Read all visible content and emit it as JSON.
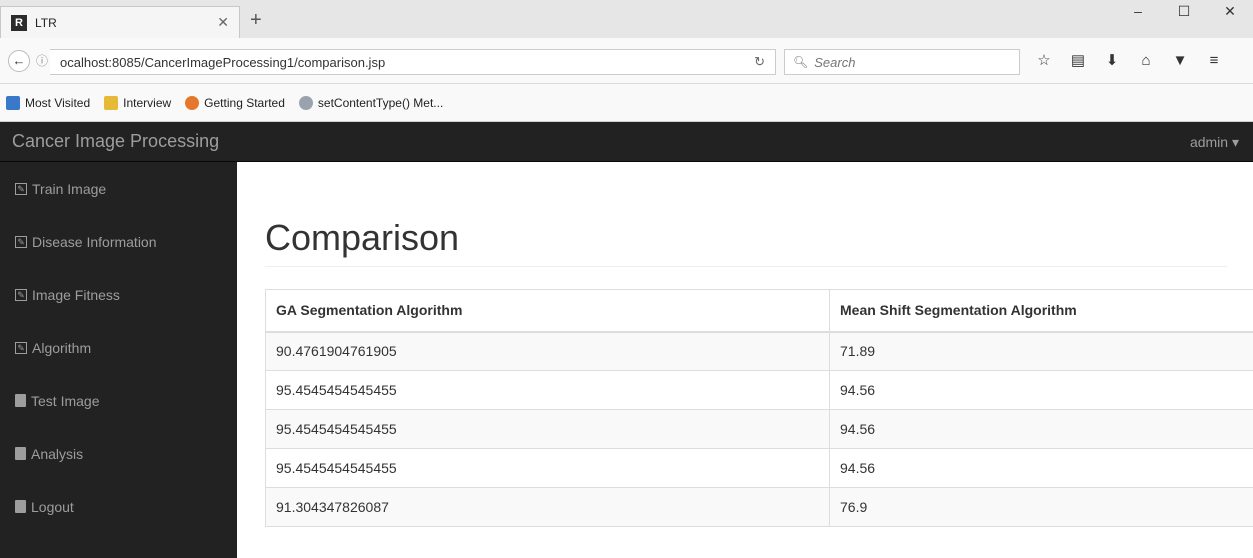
{
  "browser": {
    "tab_title": "LTR",
    "tab_icon": "R",
    "url": "ocalhost:8085/CancerImageProcessing1/comparison.jsp",
    "search_placeholder": "Search",
    "bookmarks": [
      "Most Visited",
      "Interview",
      "Getting Started",
      "setContentType() Met..."
    ]
  },
  "app": {
    "brand": "Cancer Image Processing",
    "user": "admin ▾"
  },
  "sidebar": {
    "items": [
      {
        "label": "Train Image",
        "icon": "edit-icon"
      },
      {
        "label": "Disease Information",
        "icon": "edit-icon"
      },
      {
        "label": "Image Fitness",
        "icon": "edit-icon"
      },
      {
        "label": "Algorithm",
        "icon": "edit-icon"
      },
      {
        "label": "Test Image",
        "icon": "file-icon"
      },
      {
        "label": "Analysis",
        "icon": "file-icon"
      },
      {
        "label": "Logout",
        "icon": "file-icon"
      }
    ]
  },
  "main": {
    "title": "Comparison",
    "table": {
      "headers": [
        "GA Segmentation Algorithm",
        "Mean Shift Segmentation Algorithm"
      ],
      "rows": [
        [
          "90.4761904761905",
          "71.89"
        ],
        [
          "95.4545454545455",
          "94.56"
        ],
        [
          "95.4545454545455",
          "94.56"
        ],
        [
          "95.4545454545455",
          "94.56"
        ],
        [
          "91.304347826087",
          "76.9"
        ]
      ]
    }
  },
  "colors": {
    "navbar_bg": "#222222",
    "navbar_text": "#9d9d9d",
    "table_stripe": "#f9f9f9",
    "border": "#dddddd"
  }
}
